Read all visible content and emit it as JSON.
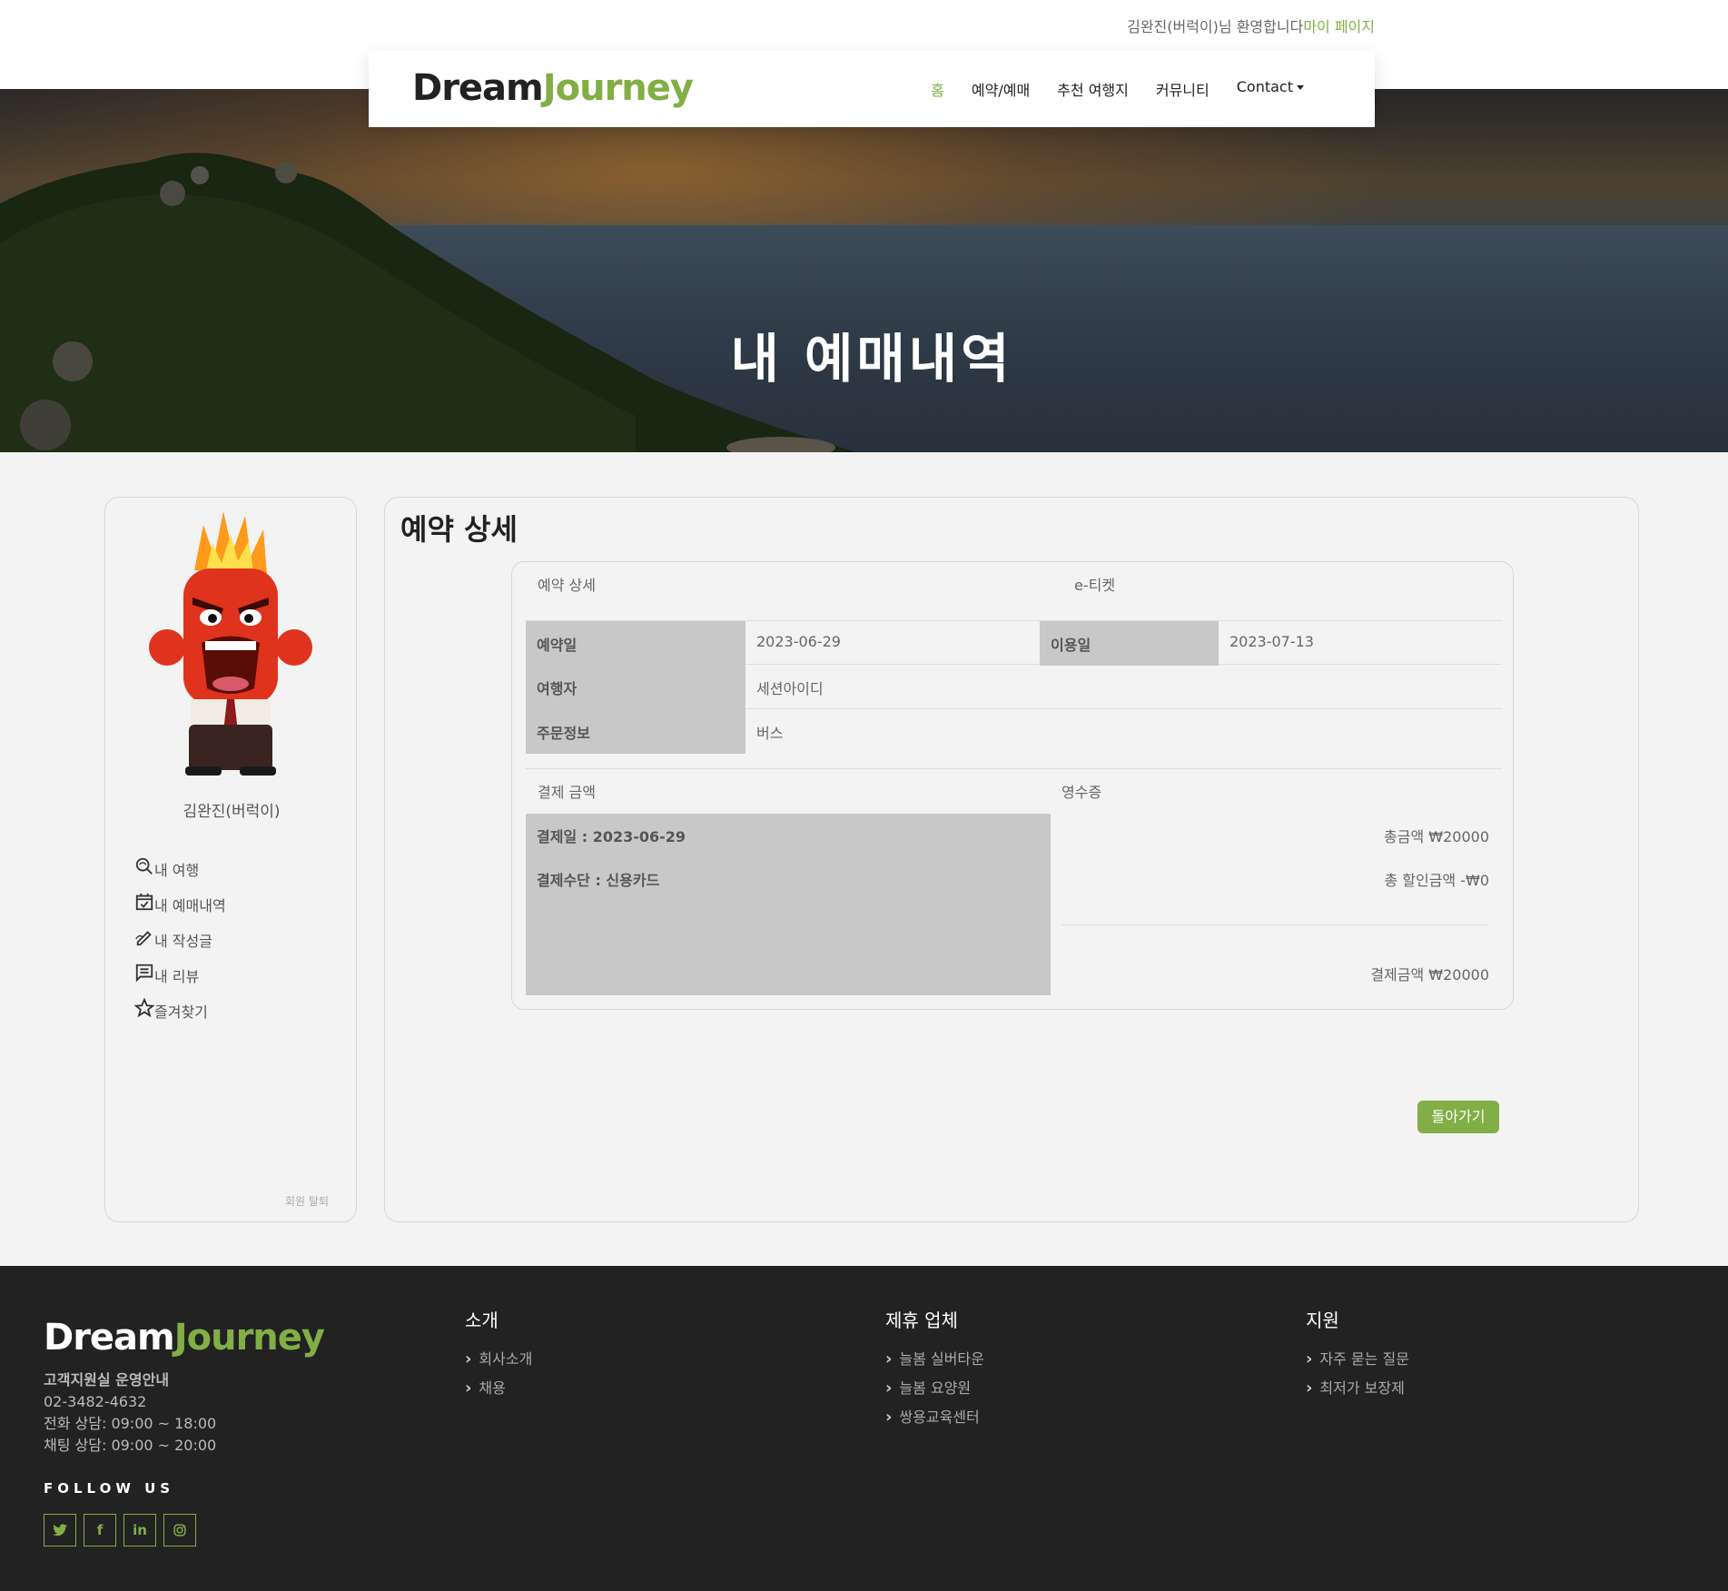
{
  "welcome": {
    "text": "김완진(버럭이)님 환영합니다",
    "link": "마이 페이지"
  },
  "logo": {
    "part1": "Dream",
    "part2": "Journey"
  },
  "nav": [
    "홈",
    "예약/예매",
    "추천 여행지",
    "커뮤니티",
    "Contact"
  ],
  "hero": {
    "title": "내 예매내역"
  },
  "sidebar": {
    "username": "김완진(버럭이)",
    "items": [
      {
        "label": "내 여행",
        "icon": "travel-search-icon"
      },
      {
        "label": "내 예매내역",
        "icon": "calendar-check-icon"
      },
      {
        "label": "내 작성글",
        "icon": "pen-icon"
      },
      {
        "label": "내 리뷰",
        "icon": "comment-icon"
      },
      {
        "label": "즐겨찾기",
        "icon": "star-icon"
      }
    ],
    "withdraw": "회원 탈퇴"
  },
  "detail": {
    "title": "예약 상세",
    "tab_detail": "예약 상세",
    "tab_ticket": "e-티켓",
    "rows": {
      "booking_date_label": "예약일",
      "booking_date": "2023-06-29",
      "use_date_label": "이용일",
      "use_date": "2023-07-13",
      "traveler_label": "여행자",
      "traveler": "세션아이디",
      "order_label": "주문정보",
      "order": "버스"
    },
    "payment_title": "결제 금액",
    "receipt_title": "영수증",
    "pay_date": "결제일 : 2023-06-29",
    "pay_method": "결제수단 : 신용카드",
    "total": "총금액 ₩20000",
    "discount": "총 할인금액 -₩0",
    "paid": "결제금액 ₩20000",
    "back": "돌아가기"
  },
  "footer": {
    "logo1": "Dream",
    "logo2": "Journey",
    "support_title": "고객지원실 운영안내",
    "phone": "02-3482-4632",
    "phone_hours": "전화 상담: 09:00 ~ 18:00",
    "chat_hours": "채팅 상담: 09:00 ~ 20:00",
    "follow": "FOLLOW US",
    "socials": [
      "twitter-icon",
      "facebook-icon",
      "linkedin-icon",
      "instagram-icon"
    ],
    "col1": {
      "title": "소개",
      "links": [
        "회사소개",
        "채용"
      ]
    },
    "col2": {
      "title": "제휴 업체",
      "links": [
        "늘봄 실버타운",
        "늘봄 요양원",
        "쌍용교육센터"
      ]
    },
    "col3": {
      "title": "지원",
      "links": [
        "자주 묻는 질문",
        "최저가 보장제"
      ]
    }
  },
  "colors": {
    "accent": "#82ae46",
    "footer_bg": "#222222",
    "label_bg": "#c8c8c8"
  }
}
